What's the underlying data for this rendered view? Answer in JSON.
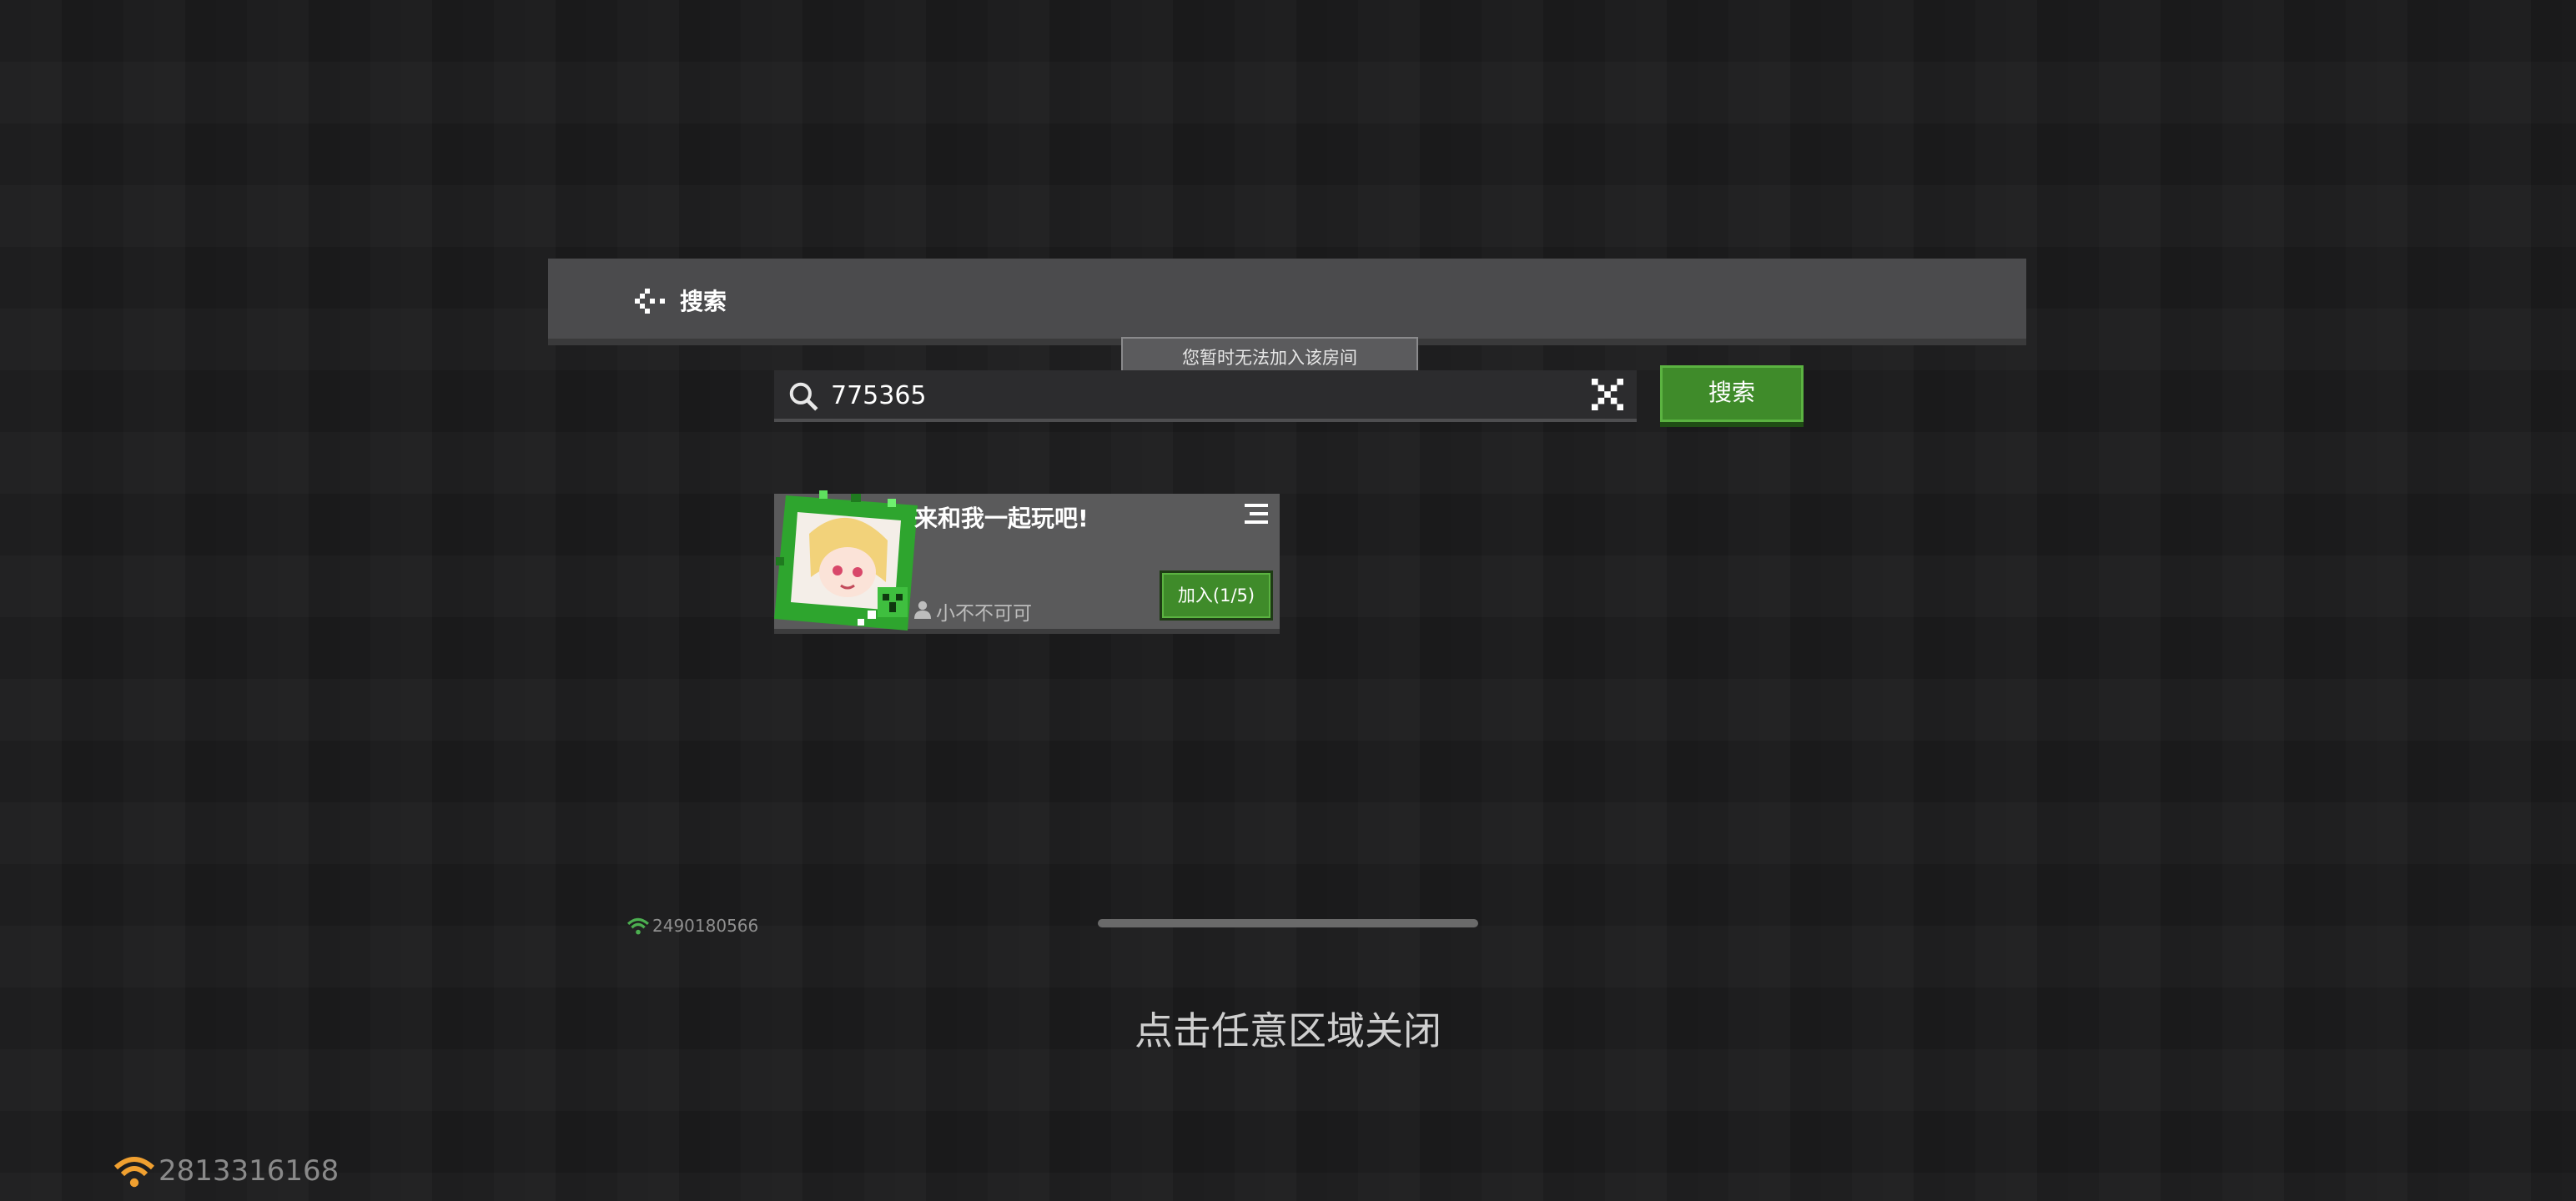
{
  "header": {
    "title": "搜索"
  },
  "toast": {
    "message": "您暂时无法加入该房间"
  },
  "search": {
    "value": "775365",
    "button_label": "搜索"
  },
  "rooms": [
    {
      "title": "来和我一起玩吧!",
      "host": "小不不可可",
      "join_label": "加入(1/5)"
    }
  ],
  "status": {
    "small_id": "2490180566",
    "bottom_id": "2813316168"
  },
  "overlay": {
    "close_hint": "点击任意区域关闭"
  },
  "colors": {
    "accent_green": "#3f8b2a",
    "header_bg": "#4b4b4d",
    "wifi_green": "#4caf50",
    "wifi_orange": "#f0a030"
  },
  "icons": [
    "back-arrow-icon",
    "search-icon",
    "clear-icon",
    "menu-icon",
    "user-icon",
    "wifi-icon"
  ]
}
